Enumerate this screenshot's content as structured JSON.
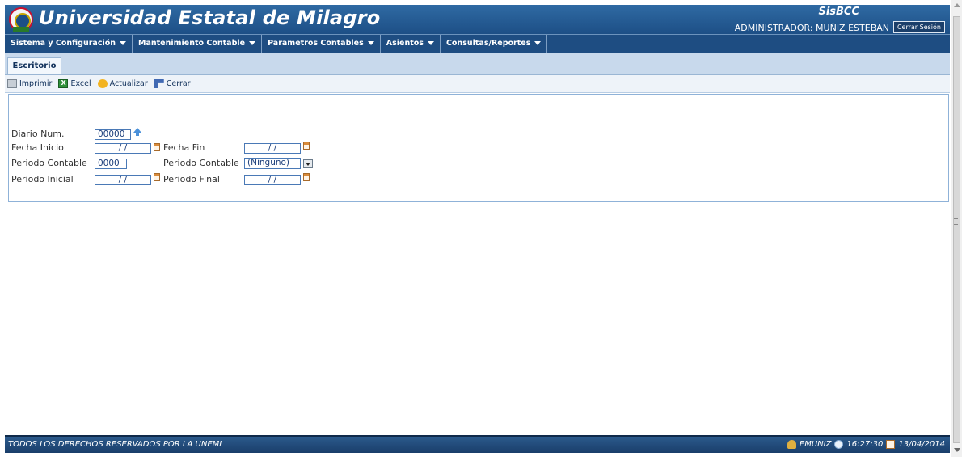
{
  "header": {
    "title": "Universidad Estatal de Milagro",
    "system_name": "SisBCC",
    "user_label": "ADMINISTRADOR: MUÑIZ ESTEBAN",
    "logout_label": "Cerrar Sesión",
    "logo_icon": "university-seal-icon"
  },
  "menu": {
    "items": [
      {
        "label": "Sistema y Configuración"
      },
      {
        "label": "Mantenimiento Contable"
      },
      {
        "label": "Parametros Contables"
      },
      {
        "label": "Asientos"
      },
      {
        "label": "Consultas/Reportes"
      }
    ]
  },
  "tabs": [
    {
      "label": "Escritorio",
      "active": true
    }
  ],
  "toolbar": {
    "print": {
      "label": "Imprimir",
      "icon": "printer-icon"
    },
    "excel": {
      "label": "Excel",
      "icon": "excel-icon"
    },
    "refresh": {
      "label": "Actualizar",
      "icon": "refresh-icon"
    },
    "close": {
      "label": "Cerrar",
      "icon": "close-icon"
    }
  },
  "form": {
    "diario_num": {
      "label": "Diario Num.",
      "value": "00000"
    },
    "fecha_inicio": {
      "label": "Fecha Inicio",
      "value": "/ /"
    },
    "fecha_fin": {
      "label": "Fecha Fin",
      "value": "/ /"
    },
    "periodo_contable": {
      "label": "Periodo Contable",
      "value": "0000"
    },
    "periodo_contable_select": {
      "label": "Periodo Contable",
      "value": "(Ninguno)"
    },
    "periodo_inicial": {
      "label": "Periodo Inicial",
      "value": "/ /"
    },
    "periodo_final": {
      "label": "Periodo Final",
      "value": "/ /"
    }
  },
  "footer": {
    "rights": "TODOS LOS DERECHOS RESERVADOS POR LA UNEMI",
    "user": "EMUNIZ",
    "time": "16:27:30",
    "date": "13/04/2014"
  },
  "colors": {
    "header_blue": "#2f6aa3",
    "menu_blue": "#1e4d82",
    "tab_strip": "#c8d9ec",
    "field_border": "#4a79b6"
  }
}
